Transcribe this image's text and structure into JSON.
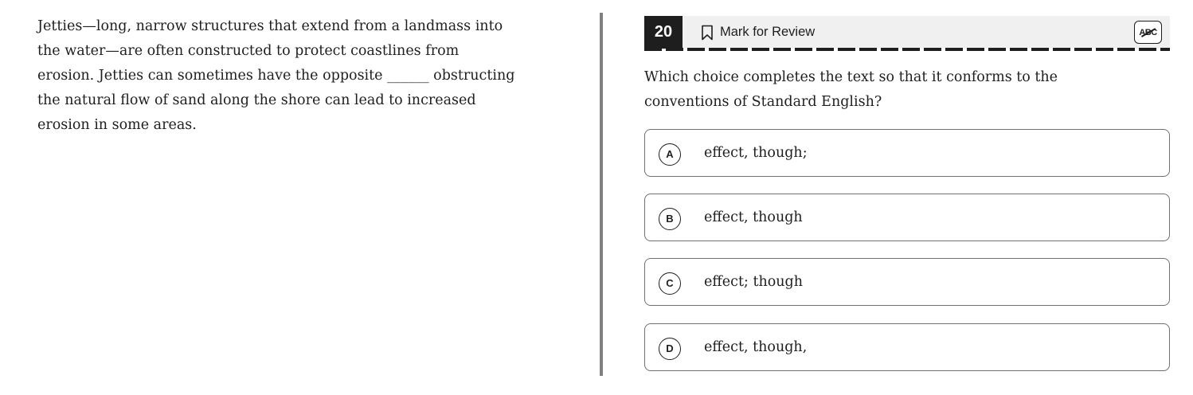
{
  "passage": {
    "lines": [
      "Jetties—long, narrow structures that extend from a landmass into",
      "the water—are often constructed to protect coastlines from",
      "erosion. Jetties can sometimes have the opposite ______ obstructing",
      "the natural flow of sand along the shore can lead to increased",
      "erosion in some areas."
    ]
  },
  "question_header": {
    "number": "20",
    "mark_for_review_label": "Mark for Review",
    "bookmark_icon": "bookmark-icon",
    "eliminator_button_label": "ABC",
    "eliminator_icon": "abc-strikethrough-icon"
  },
  "question": {
    "lines": [
      "Which choice completes the text so that it conforms to the",
      "conventions of Standard English?"
    ]
  },
  "choices": [
    {
      "letter": "A",
      "text": "effect, though;"
    },
    {
      "letter": "B",
      "text": "effect, though"
    },
    {
      "letter": "C",
      "text": "effect; though"
    },
    {
      "letter": "D",
      "text": "effect, though,"
    }
  ],
  "colors": {
    "header_background": "#f0f0f0",
    "number_badge": "#1e1e1e",
    "divider": "#808080",
    "choice_border": "#707070"
  }
}
